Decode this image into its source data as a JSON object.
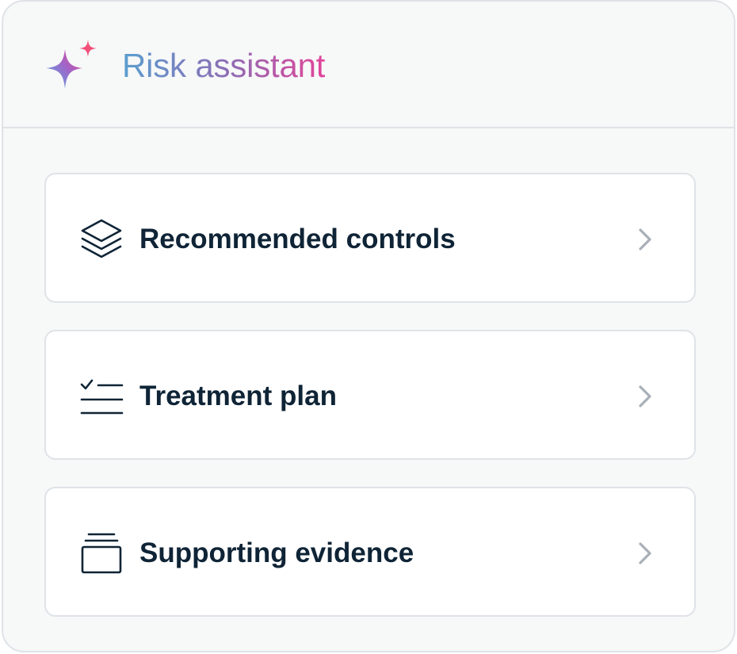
{
  "header": {
    "title": "Risk assistant",
    "icon": "sparkle-icon",
    "title_gradient": [
      "#5b9fd0",
      "#8a6fb5",
      "#e2449a"
    ]
  },
  "items": [
    {
      "label": "Recommended controls",
      "icon": "layers-icon"
    },
    {
      "label": "Treatment plan",
      "icon": "checklist-icon"
    },
    {
      "label": "Supporting evidence",
      "icon": "stack-icon"
    }
  ],
  "colors": {
    "text_primary": "#0f2436",
    "border": "#dfe3e7",
    "panel_bg": "#f7f8f8",
    "chevron": "#a9b0b8"
  }
}
